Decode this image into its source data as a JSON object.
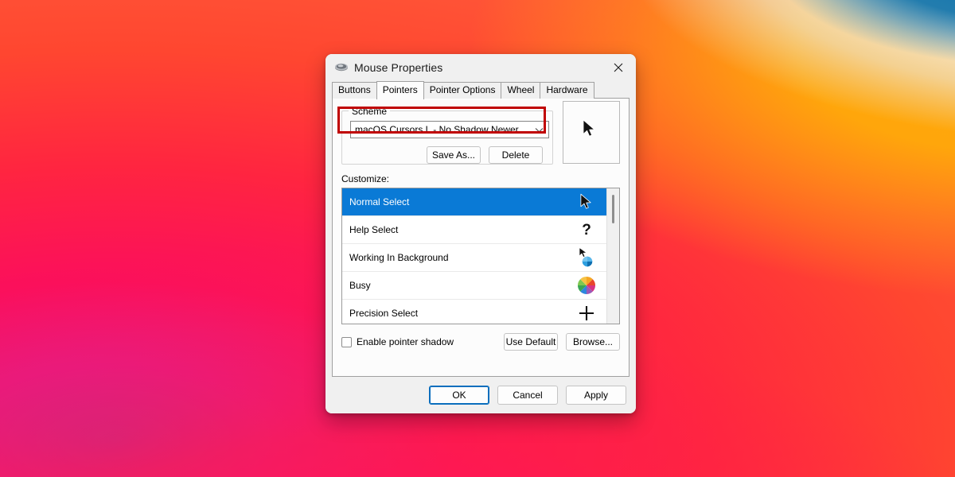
{
  "window": {
    "title": "Mouse Properties",
    "icon": "mouse-icon",
    "close_label": "✕"
  },
  "tabs": [
    {
      "label": "Buttons",
      "active": false
    },
    {
      "label": "Pointers",
      "active": true
    },
    {
      "label": "Pointer Options",
      "active": false
    },
    {
      "label": "Wheel",
      "active": false
    },
    {
      "label": "Hardware",
      "active": false
    }
  ],
  "scheme": {
    "legend": "Scheme",
    "selected": "macOS Cursors L - No Shadow Newer",
    "dropdown_icon": "chevron-down-icon",
    "save_as_label": "Save As...",
    "delete_label": "Delete",
    "highlight_color": "#c00000"
  },
  "preview": {
    "cursor": "arrow-cursor"
  },
  "customize": {
    "label": "Customize:",
    "rows": [
      {
        "label": "Normal Select",
        "cursor": "arrow-cursor",
        "selected": true
      },
      {
        "label": "Help Select",
        "cursor": "question-mark-cursor",
        "selected": false
      },
      {
        "label": "Working In Background",
        "cursor": "arrow-blue-spinner-cursor",
        "selected": false
      },
      {
        "label": "Busy",
        "cursor": "rainbow-pinwheel-cursor",
        "selected": false
      },
      {
        "label": "Precision Select",
        "cursor": "crosshair-cursor",
        "selected": false
      }
    ],
    "selection_color": "#0a7ad6"
  },
  "options": {
    "enable_pointer_shadow_label": "Enable pointer shadow",
    "enable_pointer_shadow_checked": false,
    "use_default_label": "Use Default",
    "browse_label": "Browse..."
  },
  "footer": {
    "ok_label": "OK",
    "cancel_label": "Cancel",
    "apply_label": "Apply",
    "default_button_color": "#0a6ebd"
  }
}
